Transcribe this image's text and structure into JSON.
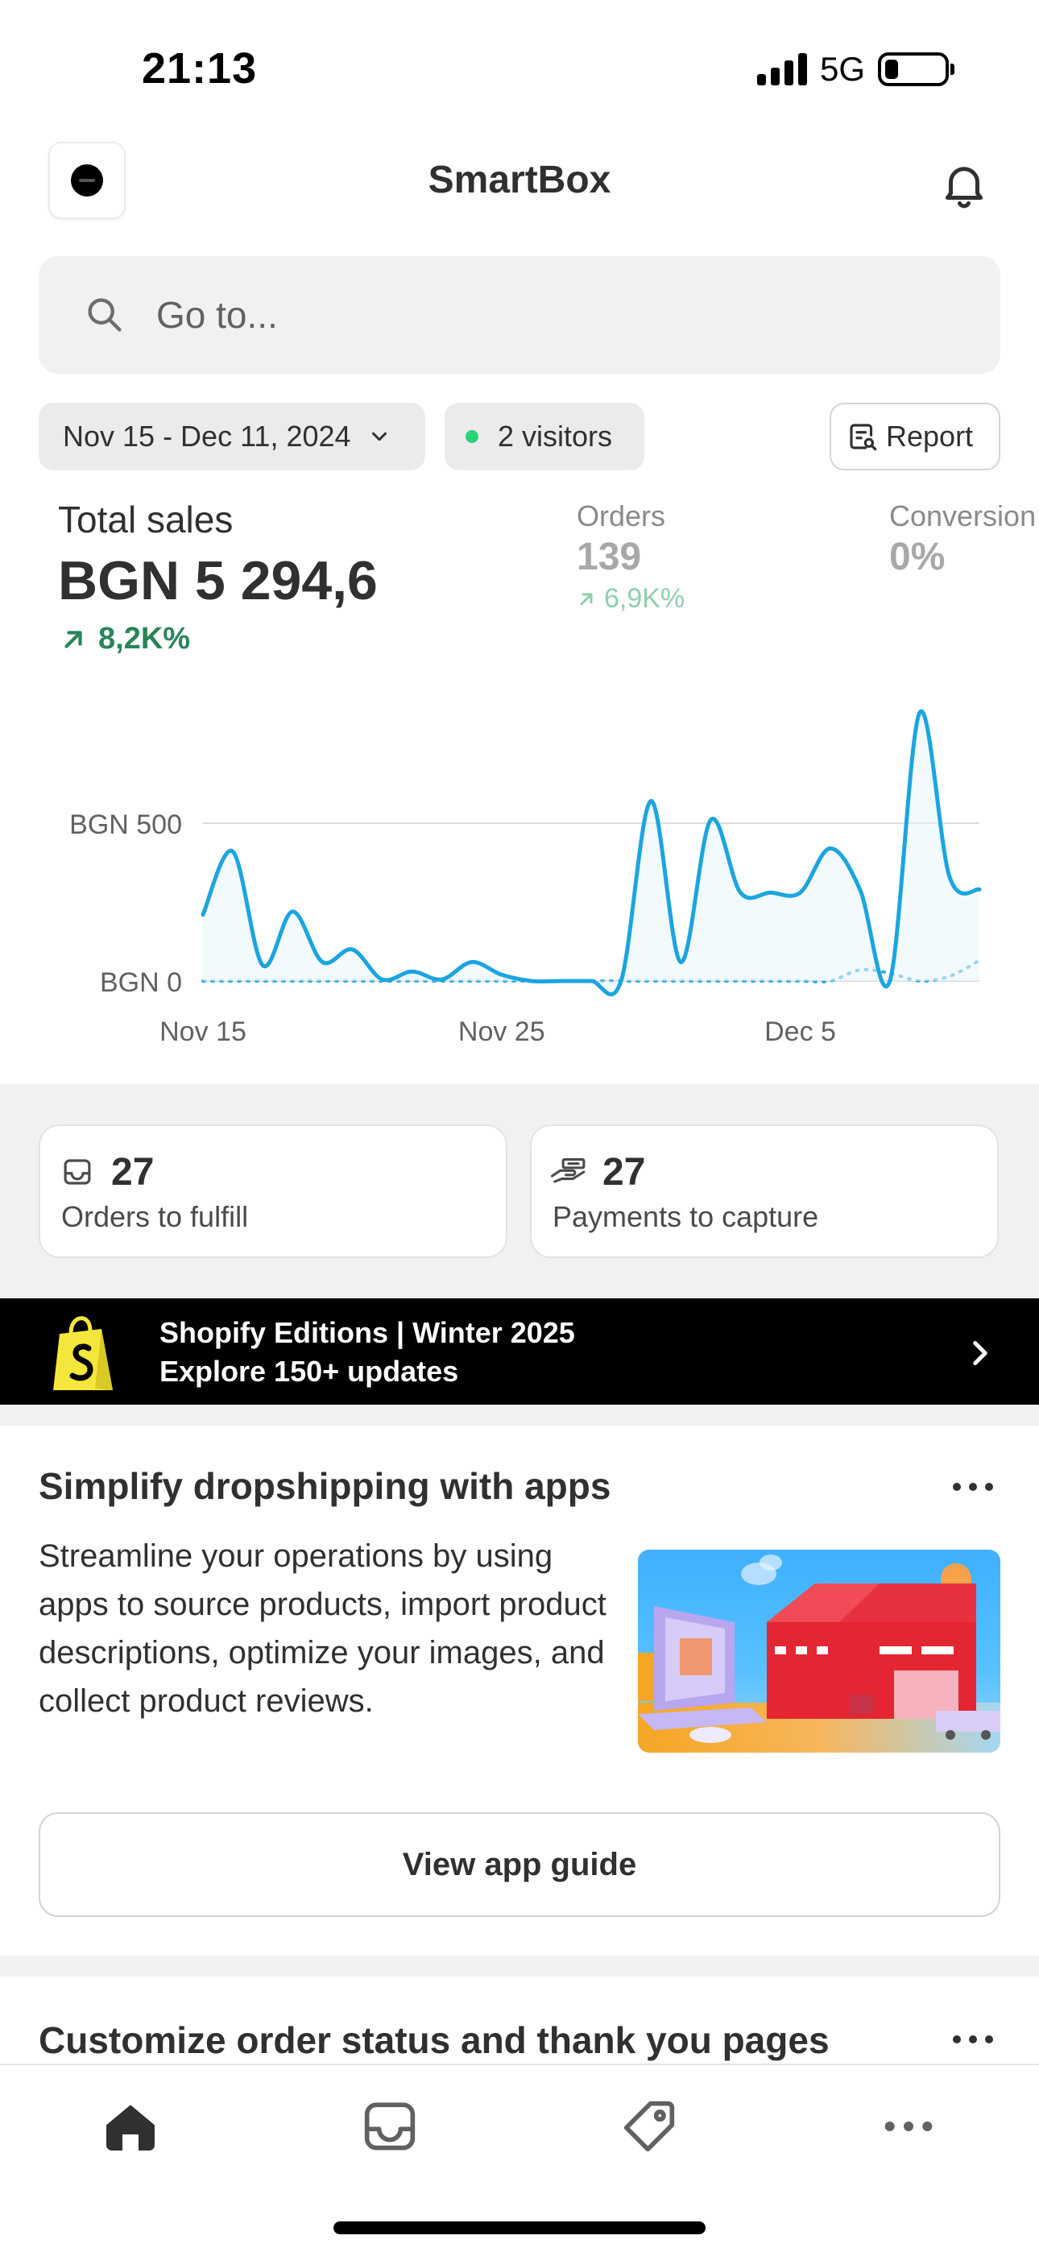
{
  "status_bar": {
    "time": "21:13",
    "network": "5G"
  },
  "header": {
    "title": "SmartBox"
  },
  "search": {
    "placeholder": "Go to..."
  },
  "filters": {
    "date_range": "Nov 15 - Dec 11, 2024",
    "visitors": "2 visitors",
    "report": "Report"
  },
  "metrics": {
    "total_sales": {
      "label": "Total sales",
      "value": "BGN 5 294,6",
      "trend": "8,2K%"
    },
    "orders": {
      "label": "Orders",
      "value": "139",
      "trend": "6,9K%"
    },
    "conversion": {
      "label": "Conversion",
      "value": "0%"
    }
  },
  "chart_data": {
    "type": "line",
    "title": "",
    "xlabel": "",
    "ylabel": "",
    "x_tick_labels": [
      "Nov 15",
      "Nov 25",
      "Dec 5"
    ],
    "y_tick_labels": [
      "BGN 500",
      "BGN 0"
    ],
    "ylim": [
      0,
      500
    ],
    "grid": true,
    "colors": {
      "current": "#1ba5e0",
      "previous": "#1ba5e0"
    },
    "series": [
      {
        "style": "solid",
        "x": [
          "Nov 15",
          "Nov 16",
          "Nov 17",
          "Nov 18",
          "Nov 19",
          "Nov 20",
          "Nov 21",
          "Nov 22",
          "Nov 23",
          "Nov 24",
          "Nov 25",
          "Nov 26",
          "Nov 27",
          "Nov 28",
          "Nov 29",
          "Nov 30",
          "Dec 1",
          "Dec 2",
          "Dec 3",
          "Dec 4",
          "Dec 5",
          "Dec 6",
          "Dec 7",
          "Dec 8",
          "Dec 9",
          "Dec 10",
          "Dec 11"
        ],
        "values": [
          210,
          410,
          50,
          220,
          60,
          100,
          5,
          30,
          5,
          60,
          20,
          0,
          0,
          0,
          0,
          570,
          60,
          510,
          280,
          280,
          280,
          420,
          290,
          0,
          850,
          330,
          290
        ]
      },
      {
        "style": "dotted",
        "x": [
          "Nov 15",
          "Nov 16",
          "Nov 17",
          "Nov 18",
          "Nov 19",
          "Nov 20",
          "Nov 21",
          "Nov 22",
          "Nov 23",
          "Nov 24",
          "Nov 25",
          "Nov 26",
          "Nov 27",
          "Nov 28",
          "Nov 29",
          "Nov 30",
          "Dec 1",
          "Dec 2",
          "Dec 3",
          "Dec 4",
          "Dec 5",
          "Dec 6",
          "Dec 7",
          "Dec 8",
          "Dec 9",
          "Dec 10",
          "Dec 11"
        ],
        "values": [
          0,
          0,
          0,
          0,
          0,
          0,
          0,
          0,
          0,
          0,
          0,
          0,
          0,
          0,
          0,
          0,
          0,
          0,
          0,
          0,
          0,
          0,
          35,
          25,
          0,
          15,
          65
        ]
      }
    ]
  },
  "cards": [
    {
      "count": "27",
      "label": "Orders to fulfill",
      "icon": "inbox-icon"
    },
    {
      "count": "27",
      "label": "Payments to capture",
      "icon": "cash-hand-icon"
    }
  ],
  "promo": {
    "line1": "Shopify Editions | Winter 2025",
    "line2": "Explore 150+ updates"
  },
  "guide": {
    "title": "Simplify dropshipping with apps",
    "body": "Streamline your operations by using apps to source products, import product descriptions, optimize your images, and collect product reviews.",
    "button": "View app guide"
  },
  "next_section": {
    "title": "Customize order status and thank you pages"
  },
  "bottom_nav": [
    "home-icon",
    "orders-icon",
    "products-tag-icon",
    "more-icon"
  ],
  "colors": {
    "accent": "#1ba5e0",
    "positive": "#29845a",
    "promo_bg": "#000000"
  }
}
